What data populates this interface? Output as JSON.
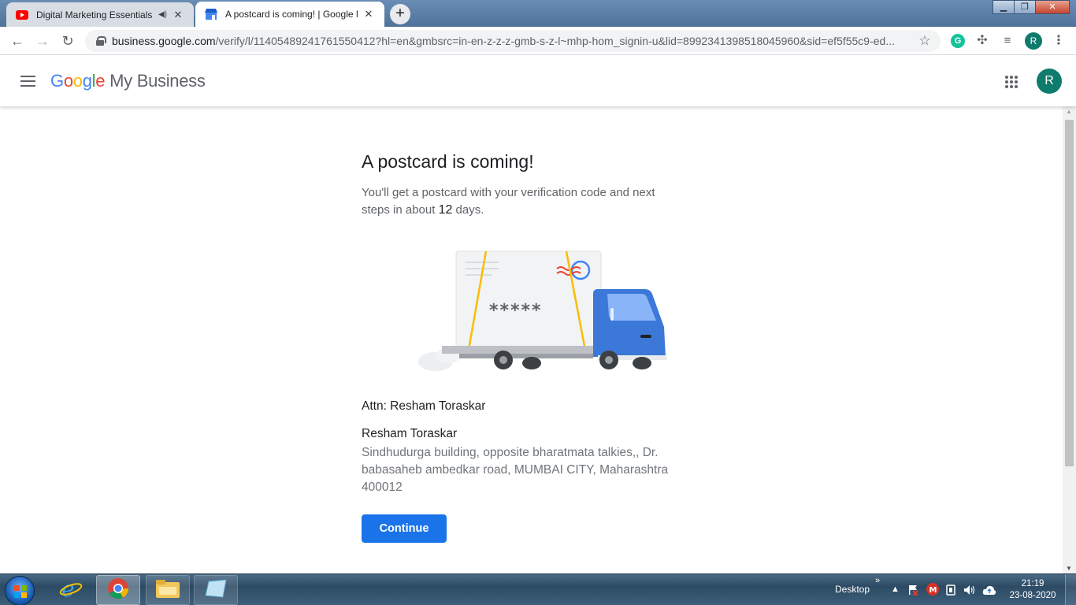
{
  "browser": {
    "tabs": [
      {
        "title": "Digital Marketing Essentials |",
        "favicon": "youtube-icon",
        "audio": "speaker-icon",
        "active": false
      },
      {
        "title": "A postcard is coming! | Google M",
        "favicon": "google-my-business-icon",
        "active": true
      }
    ],
    "new_tab_label": "+",
    "window_controls": {
      "minimize": "▁",
      "restore": "❐",
      "close": "✕"
    },
    "url_host": "business.google.com",
    "url_path": "/verify/l/11405489241761550412?hl=en&gmbsrc=in-en-z-z-z-gmb-s-z-l~mhp-hom_signin-u&lid=8992341398518045960&sid=ef5f55c9-ed...",
    "profile_initial": "R",
    "extension_grammarly": "G"
  },
  "header": {
    "logo_letters": [
      "G",
      "o",
      "o",
      "g",
      "l",
      "e"
    ],
    "product_name": "My Business",
    "avatar_initial": "R"
  },
  "main": {
    "title": "A postcard is coming!",
    "lead_before": "You'll get a postcard with your verification code and next steps in about ",
    "lead_days": "12",
    "lead_after": " days.",
    "postcard_code": "*****",
    "attn": "Attn: Resham Toraskar",
    "recipient_name": "Resham Toraskar",
    "address": "Sindhudurga building, opposite bharatmata talkies,, Dr. babasaheb ambedkar road, MUMBAI CITY, Maharashtra 400012",
    "continue_label": "Continue"
  },
  "taskbar": {
    "desktop_label": "Desktop",
    "chevron": "»",
    "time": "21:19",
    "date": "23-08-2020"
  },
  "colors": {
    "brand_blue": "#1a73e8",
    "avatar_green": "#0f7b6c",
    "truck_blue": "#3c78d8"
  }
}
